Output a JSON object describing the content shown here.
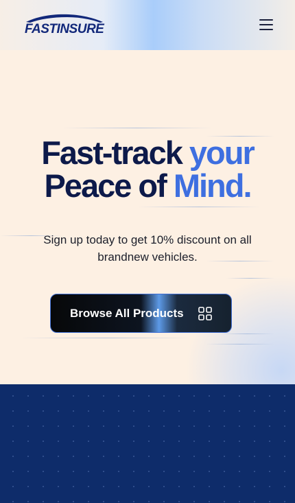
{
  "header": {
    "logo_text": "FASTINSURE",
    "menu_icon": "hamburger-icon"
  },
  "hero": {
    "headline_line1_dark": "Fast-track",
    "headline_line1_blue": "your",
    "headline_line2_dark": "Peace of",
    "headline_line2_blue": "Mind.",
    "subtitle": "Sign up today to get 10% discount on all brandnew vehicles.",
    "cta_label": "Browse All Products",
    "cta_icon": "grid-icon"
  },
  "colors": {
    "brand_navy": "#12287a",
    "headline_dark": "#0d1a4a",
    "headline_blue": "#3e6fe0",
    "footer_bg": "#0e2c6a"
  }
}
